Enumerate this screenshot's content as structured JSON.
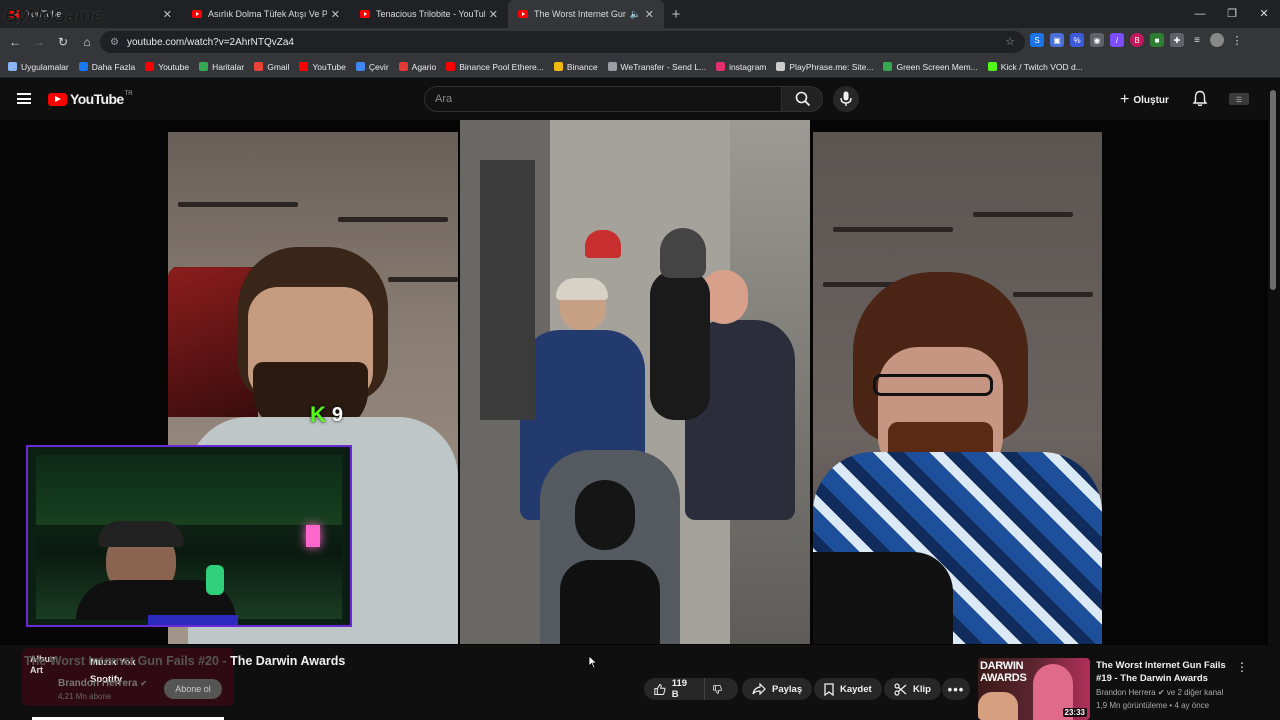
{
  "browser": {
    "tabs": [
      {
        "title": "YouTube"
      },
      {
        "title": "Asırlık Dolma Tüfek Atışı Ve Pat"
      },
      {
        "title": "Tenacious Trilobite - YouTube"
      },
      {
        "title": "The Worst Internet Gun Fails"
      }
    ],
    "url": "youtube.com/watch?v=2AhrNTQvZa4",
    "overlay_logo": "ByNoGame",
    "bookmarks": [
      {
        "label": "Uygulamalar",
        "color": "#8ab4f8"
      },
      {
        "label": "Daha Fazla",
        "color": "#1877f2"
      },
      {
        "label": "Youtube",
        "color": "#ff0000"
      },
      {
        "label": "Haritalar",
        "color": "#34a853"
      },
      {
        "label": "Gmail",
        "color": "#ea4335"
      },
      {
        "label": "YouTube",
        "color": "#ff0000"
      },
      {
        "label": "Çevir",
        "color": "#4285f4"
      },
      {
        "label": "Agario",
        "color": "#e53935"
      },
      {
        "label": "Binance Pool Ethere...",
        "color": "#ff0000"
      },
      {
        "label": "Binance",
        "color": "#f0b90b"
      },
      {
        "label": "WeTransfer - Send L...",
        "color": "#9aa0a6"
      },
      {
        "label": "instagram",
        "color": "#e1306c"
      },
      {
        "label": "PlayPhrase.me: Site...",
        "color": "#cccccc"
      },
      {
        "label": "Green Screen Mem...",
        "color": "#34a853"
      },
      {
        "label": "Kick / Twitch VOD d...",
        "color": "#53fc18"
      }
    ]
  },
  "header": {
    "logo_text": "YouTube",
    "logo_region": "TR",
    "search_placeholder": "Ara",
    "create_label": "Oluştur"
  },
  "player": {
    "overlay_score": "9"
  },
  "music_widget": {
    "art_label": "Album Art",
    "title": "Müzik Yok",
    "artist": "Spotify"
  },
  "video": {
    "title_faded": "The Worst Internet Gun Fails #20 - ",
    "title_main": "The Darwin Awards",
    "channel": "Brandon Herrera",
    "subscribers": "4,21 Mn abone",
    "subscribe_label": "Abone ol",
    "likes": "119 B",
    "share_label": "Paylaş",
    "save_label": "Kaydet",
    "clip_label": "Klip",
    "progress": 0.15
  },
  "recommended": {
    "thumb_text": "DARWIN AWARDS",
    "duration": "23:33",
    "title": "The Worst Internet Gun Fails #19 - The Darwin Awards",
    "channel": "Brandon Herrera",
    "channel_extra": "ve 2 diğer kanal",
    "meta": "1,9 Mn görüntüleme • 4 ay önce"
  }
}
